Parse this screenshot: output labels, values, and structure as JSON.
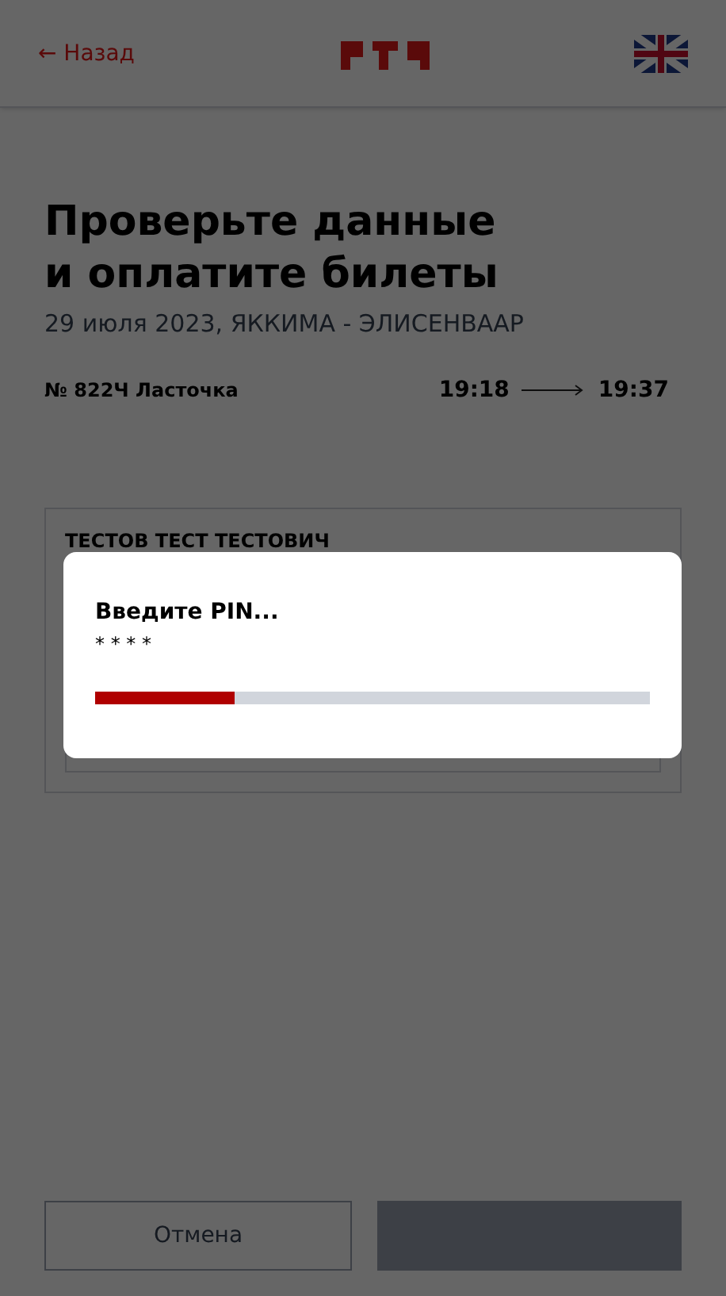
{
  "header": {
    "back": "← Назад"
  },
  "title": "Проверьте данные и оплатите билеты",
  "subtitle": "29 июля 2023, ЯККИМА - ЭЛИСЕНВААР",
  "train": {
    "name": "№ 822Ч Ласточка",
    "departure": "19:18",
    "arrival": "19:37"
  },
  "passenger": {
    "name": "ТЕСТОВ ТЕСТ ТЕСТОВИЧ"
  },
  "dialog": {
    "title": "Введите PIN...",
    "pin": "* * * *",
    "level": 0.25
  },
  "buttons": {
    "cancel": "Отмена",
    "pay_disabled": true
  }
}
